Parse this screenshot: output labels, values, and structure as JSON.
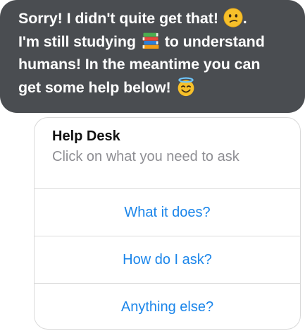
{
  "message": {
    "lines": [
      {
        "text": "Sorry! I didn't quite get that!",
        "emoji": "confused-face-icon"
      },
      {
        "text_before": "I'm still studying",
        "emoji": "books-icon",
        "text_after": "to understand"
      },
      {
        "text": "humans! In the meantime you can"
      },
      {
        "text": "get some help below!",
        "emoji": "smiling-face-with-halo-icon"
      }
    ],
    "trailing_period": ".",
    "bubble_color": "#4a4d51",
    "text_color": "#ffffff"
  },
  "help_card": {
    "title": "Help Desk",
    "subtitle": "Click on what you need to ask",
    "options": [
      {
        "label": "What it does?"
      },
      {
        "label": "How do I ask?"
      },
      {
        "label": "Anything else?"
      }
    ],
    "option_color": "#1a85ea"
  }
}
